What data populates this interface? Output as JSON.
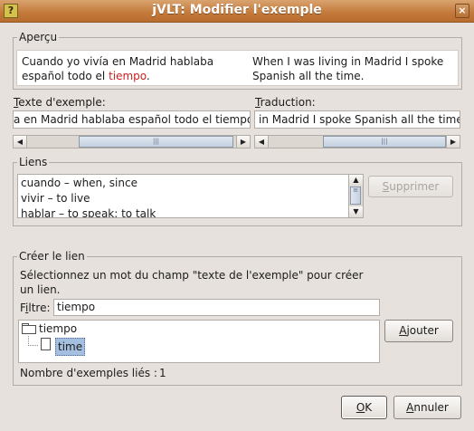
{
  "window": {
    "title": "jVLT: Modifier l'exemple",
    "app_icon_glyph": "?",
    "close_glyph": "×"
  },
  "apercu": {
    "legend": "Aperçu",
    "spanish_before": "Cuando yo vivía en Madrid hablaba español todo el ",
    "spanish_highlight": "tiempo",
    "spanish_after": ".",
    "highlight_color": "#cc1f1f",
    "english": "When I was living in Madrid I spoke Spanish all the time."
  },
  "texte": {
    "label_u": "T",
    "label_rest": "exte d'exemple:",
    "value": "a en Madrid hablaba español todo el tiempo."
  },
  "traduction": {
    "label_u": "T",
    "label_rest": "raduction:",
    "value": "in Madrid I spoke Spanish all the time."
  },
  "liens": {
    "legend": "Liens",
    "items": [
      "cuando – when, since",
      "vivir – to live",
      "hablar – to speak; to talk"
    ],
    "delete_u": "S",
    "delete_rest": "upprimer"
  },
  "creer": {
    "legend": "Créer le lien",
    "instruction": "Sélectionnez un mot du champ \"texte de l'exemple\" pour créer un lien.",
    "filter_label_u": "i",
    "filter_label_pre": "F",
    "filter_label_post": "ltre:",
    "filter_value": "tiempo",
    "tree_root": "tiempo",
    "tree_child": "time",
    "add_u": "A",
    "add_rest": "jouter",
    "count_label": "Nombre d'exemples liés :",
    "count_value": "1"
  },
  "footer": {
    "ok_u": "O",
    "ok_rest": "K",
    "cancel_u": "A",
    "cancel_rest": "nnuler"
  },
  "colors": {
    "accent": "#c3793a",
    "selection": "#a5bfe0"
  }
}
